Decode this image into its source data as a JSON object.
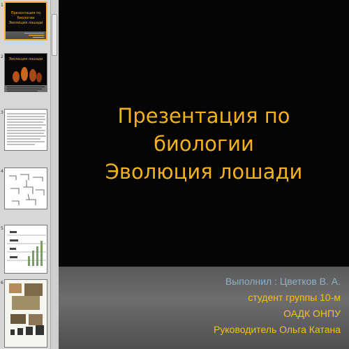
{
  "slide": {
    "title_lines": [
      "Презентация по биологии",
      "Эволюция лошади"
    ],
    "subtitle": [
      {
        "text": "Выполнил : Цветков В. А.",
        "color": "#8fb1c9"
      },
      {
        "text": "студент группы 10-м",
        "color": "#f2c21b"
      },
      {
        "text": "ОАДК ОНПУ",
        "color": "#f2c21b"
      },
      {
        "text": "Руководитель Ольга Катана",
        "color": "#f2c21b"
      }
    ]
  },
  "thumbnails": [
    {
      "number": "1",
      "title_lines": [
        "Презентация по биологии",
        "Эволюция лошади"
      ],
      "selected": true
    },
    {
      "number": "2",
      "title_lines": [
        "Эволюция лошади"
      ]
    },
    {
      "number": "3"
    },
    {
      "number": "4"
    },
    {
      "number": "5"
    },
    {
      "number": "6"
    }
  ],
  "colors": {
    "accent": "#f4b11e",
    "selection": "#f2b335"
  }
}
